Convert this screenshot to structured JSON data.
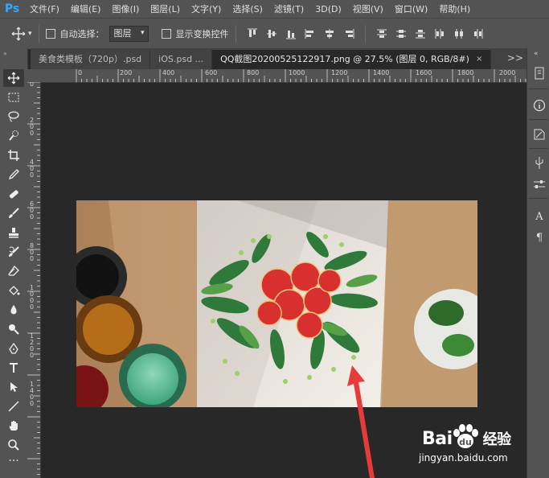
{
  "app": {
    "logo": "Ps"
  },
  "menu": [
    "文件(F)",
    "编辑(E)",
    "图像(I)",
    "图层(L)",
    "文字(Y)",
    "选择(S)",
    "滤镜(T)",
    "3D(D)",
    "视图(V)",
    "窗口(W)",
    "帮助(H)"
  ],
  "options": {
    "auto_select_label": "自动选择：",
    "auto_select_value": "图层",
    "show_transform_label": "显示变换控件"
  },
  "tabs": [
    {
      "label": "美食类模板（720p）.psd",
      "active": false
    },
    {
      "label": "iOS.psd ...",
      "active": false
    },
    {
      "label": "QQ截图20200525122917.png @ 27.5% (图层 0, RGB/8#)",
      "active": true
    }
  ],
  "tab_close": "×",
  "tab_overflow": ">>",
  "ruler": {
    "top_ticks": [
      "0",
      "200",
      "400",
      "600",
      "800",
      "1000",
      "1200",
      "1400",
      "1600",
      "1800",
      "2000"
    ],
    "left_ticks": [
      "0",
      "2\n0\n0",
      "4\n0\n0",
      "6\n0\n0",
      "8\n0\n0",
      "1\n0\n0\n0",
      "1\n2\n0\n0",
      "1\n4\n0\n0"
    ]
  },
  "tools": [
    "move-icon",
    "marquee-icon",
    "lasso-icon",
    "quick-select-icon",
    "crop-icon",
    "eyedropper-icon",
    "healing-icon",
    "brush-icon",
    "stamp-icon",
    "history-brush-icon",
    "eraser-icon",
    "paint-bucket-icon",
    "blur-icon",
    "dodge-icon",
    "pen-icon",
    "type-icon",
    "path-select-icon",
    "line-icon",
    "hand-icon",
    "zoom-icon",
    "more-icon"
  ],
  "watermark": {
    "brand": "Bai",
    "brand2": "经验",
    "url": "jingyan.baidu.com"
  },
  "colors": {
    "arrow": "#e83a3a",
    "ps_blue": "#31a8ff",
    "ui_gray": "#535353"
  }
}
